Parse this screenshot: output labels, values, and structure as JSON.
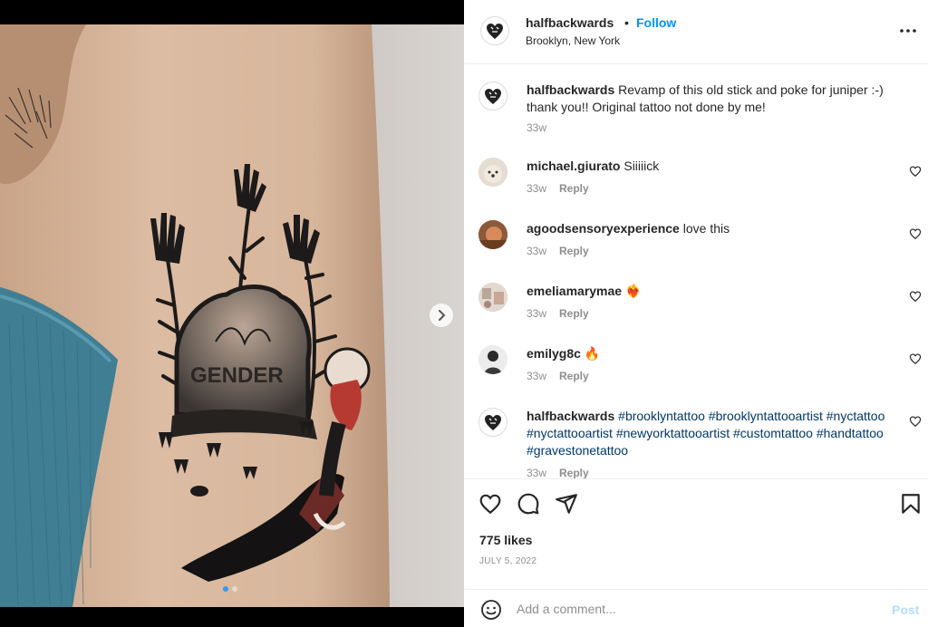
{
  "post": {
    "author": "halfbackwards",
    "separator": "•",
    "follow_label": "Follow",
    "location": "Brooklyn, New York",
    "tattoo_text": "GENDER"
  },
  "caption": {
    "user": "halfbackwards",
    "text": " Revamp of this old stick and poke for juniper :-) thank you!! Original tattoo not done by me!",
    "time": "33w"
  },
  "comments": [
    {
      "user": "michael.giurato",
      "text": " Siiiiick",
      "time": "33w",
      "reply": "Reply"
    },
    {
      "user": "agoodsensoryexperience",
      "text": " love this",
      "time": "33w",
      "reply": "Reply"
    },
    {
      "user": "emeliamarymae",
      "text": " ❤️‍🔥",
      "time": "33w",
      "reply": "Reply"
    },
    {
      "user": "emilyg8c",
      "text": " 🔥",
      "time": "33w",
      "reply": "Reply"
    }
  ],
  "tags_comment": {
    "user": "halfbackwards",
    "tags": [
      "#brooklyntattoo",
      "#brooklyntattooartist",
      "#nyctattoo",
      "#nyctattooartist",
      "#newyorktattooartist",
      "#customtattoo",
      "#handtattoo",
      "#gravestonetattoo"
    ],
    "time": "33w",
    "reply": "Reply"
  },
  "engagement": {
    "likes": "775 likes",
    "date": "JULY 5, 2022"
  },
  "add_comment": {
    "placeholder": "Add a comment...",
    "post_label": "Post"
  },
  "carousel": {
    "current": 1,
    "total": 2
  },
  "colors": {
    "accent": "#0095f6",
    "text": "#262626",
    "muted": "#8e8e8e",
    "hashtag": "#00376b",
    "post_disabled": "#b2dffc"
  },
  "icons": [
    "more-icon",
    "heart-icon",
    "comment-icon",
    "share-icon",
    "bookmark-icon",
    "emoji-icon",
    "chevron-right-icon"
  ]
}
